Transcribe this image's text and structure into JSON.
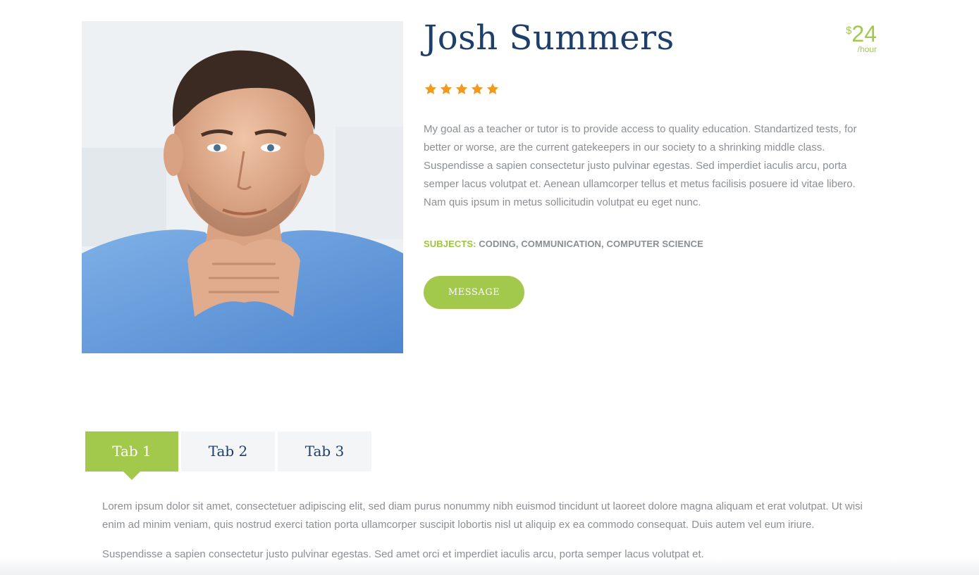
{
  "profile": {
    "name": "Josh Summers",
    "price": {
      "currency": "$",
      "amount": "24",
      "per": "/hour"
    },
    "rating": {
      "value": 5,
      "max": 5
    },
    "bio": "My goal as a teacher or tutor is to provide access to quality education. Standartized tests, for better or worse, are the current gatekeepers in our society to a shrinking middle class. Suspendisse a sapien consectetur justo pulvinar egestas. Sed imperdiet iaculis arcu, porta semper lacus volutpat et. Aenean ullamcorper tellus et metus facilisis posuere id vitae libero. Nam quis ipsum in metus sollicitudin volutpat eu eget nunc.",
    "subjects_label": "SUBJECTS:",
    "subjects_value": "CODING, COMMUNICATION, COMPUTER SCIENCE",
    "message_label": "MESSAGE"
  },
  "tabs": [
    {
      "label": "Tab 1",
      "active": true
    },
    {
      "label": "Tab 2",
      "active": false
    },
    {
      "label": "Tab 3",
      "active": false
    }
  ],
  "tab_content": {
    "p1": "Lorem ipsum dolor sit amet, consectetuer adipiscing elit, sed diam purus nonummy nibh euismod tincidunt ut laoreet dolore magna aliquam et erat volutpat. Ut wisi enim ad minim veniam, quis nostrud exerci tation porta ullamcorper suscipit lobortis nisl ut aliquip ex ea commodo consequat. Duis autem vel eum iriure.",
    "p2": "Suspendisse a sapien consectetur justo pulvinar egestas. Sed amet orci et imperdiet iaculis arcu, porta semper lacus volutpat et."
  },
  "colors": {
    "accent_green": "#a2c94c",
    "navy": "#1e3f6b",
    "star_orange": "#f29a1f",
    "body_gray": "#8b8f93"
  },
  "icons": {
    "star": "star-icon"
  }
}
